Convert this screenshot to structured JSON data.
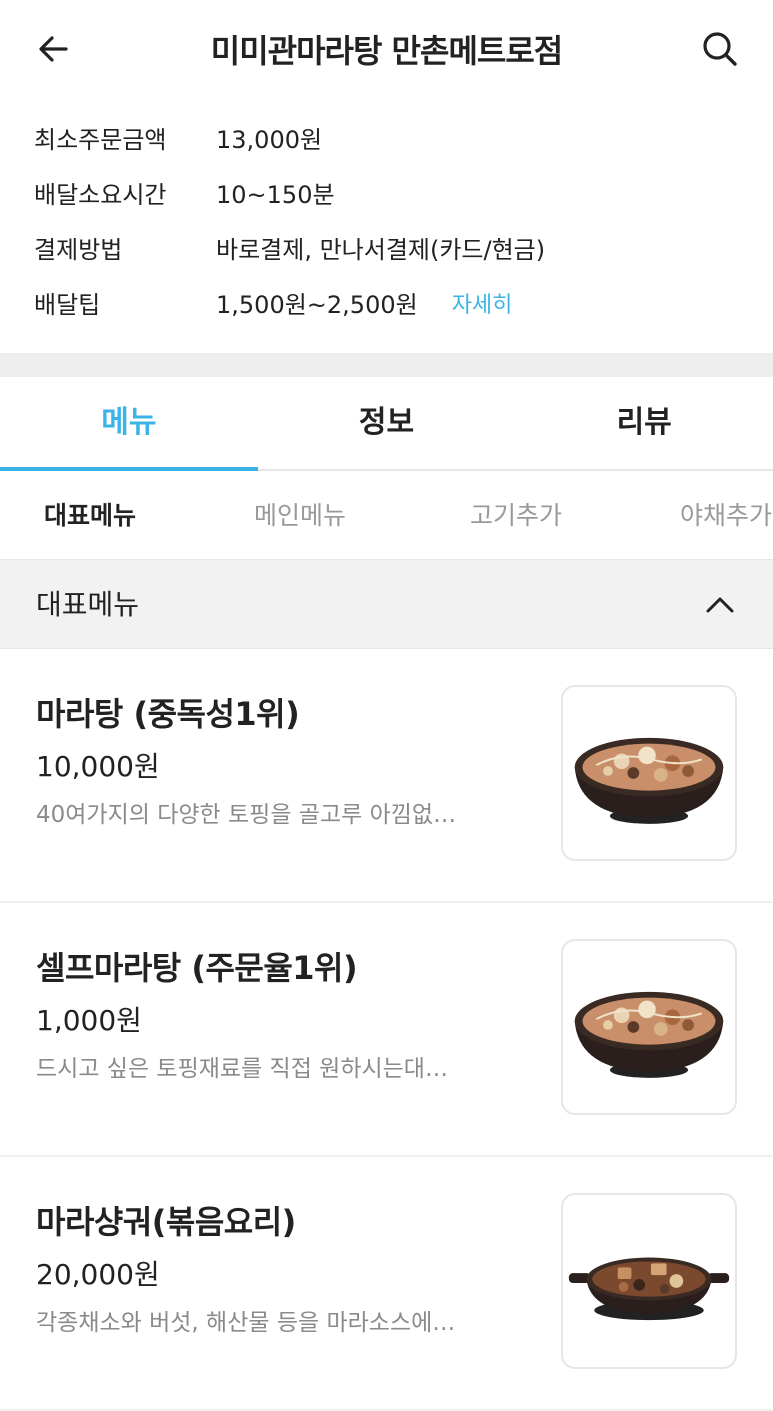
{
  "header": {
    "title": "미미관마라탕 만촌메트로점",
    "back_icon": "arrow-left-icon",
    "search_icon": "search-icon"
  },
  "info": [
    {
      "label": "최소주문금액",
      "value": "13,000원"
    },
    {
      "label": "배달소요시간",
      "value": "10~150분"
    },
    {
      "label": "결제방법",
      "value": "바로결제, 만나서결제(카드/현금)"
    },
    {
      "label": "배달팁",
      "value": "1,500원~2,500원",
      "link": "자세히"
    }
  ],
  "tabs": [
    "메뉴",
    "정보",
    "리뷰"
  ],
  "active_tab": "메뉴",
  "subtabs": [
    "대표메뉴",
    "메인메뉴",
    "고기추가",
    "야채추가"
  ],
  "active_subtab": "대표메뉴",
  "section": {
    "title": "대표메뉴",
    "toggle_icon": "chevron-up-icon"
  },
  "menu_items": [
    {
      "name": "마라탕 (중독성1위)",
      "price": "10,000원",
      "desc": "40여가지의 다양한 토핑을 골고루 아낌없…"
    },
    {
      "name": "셀프마라탕 (주문율1위)",
      "price": "1,000원",
      "desc": "드시고 싶은 토핑재료를 직접 원하시는대…"
    },
    {
      "name": "마라샹궈(볶음요리)",
      "price": "20,000원",
      "desc": "각종채소와 버섯, 해산물 등을 마라소스에…"
    }
  ],
  "colors": {
    "accent": "#3ab4e6",
    "divider": "#eeeeee",
    "muted_text": "#8a8a8a"
  }
}
